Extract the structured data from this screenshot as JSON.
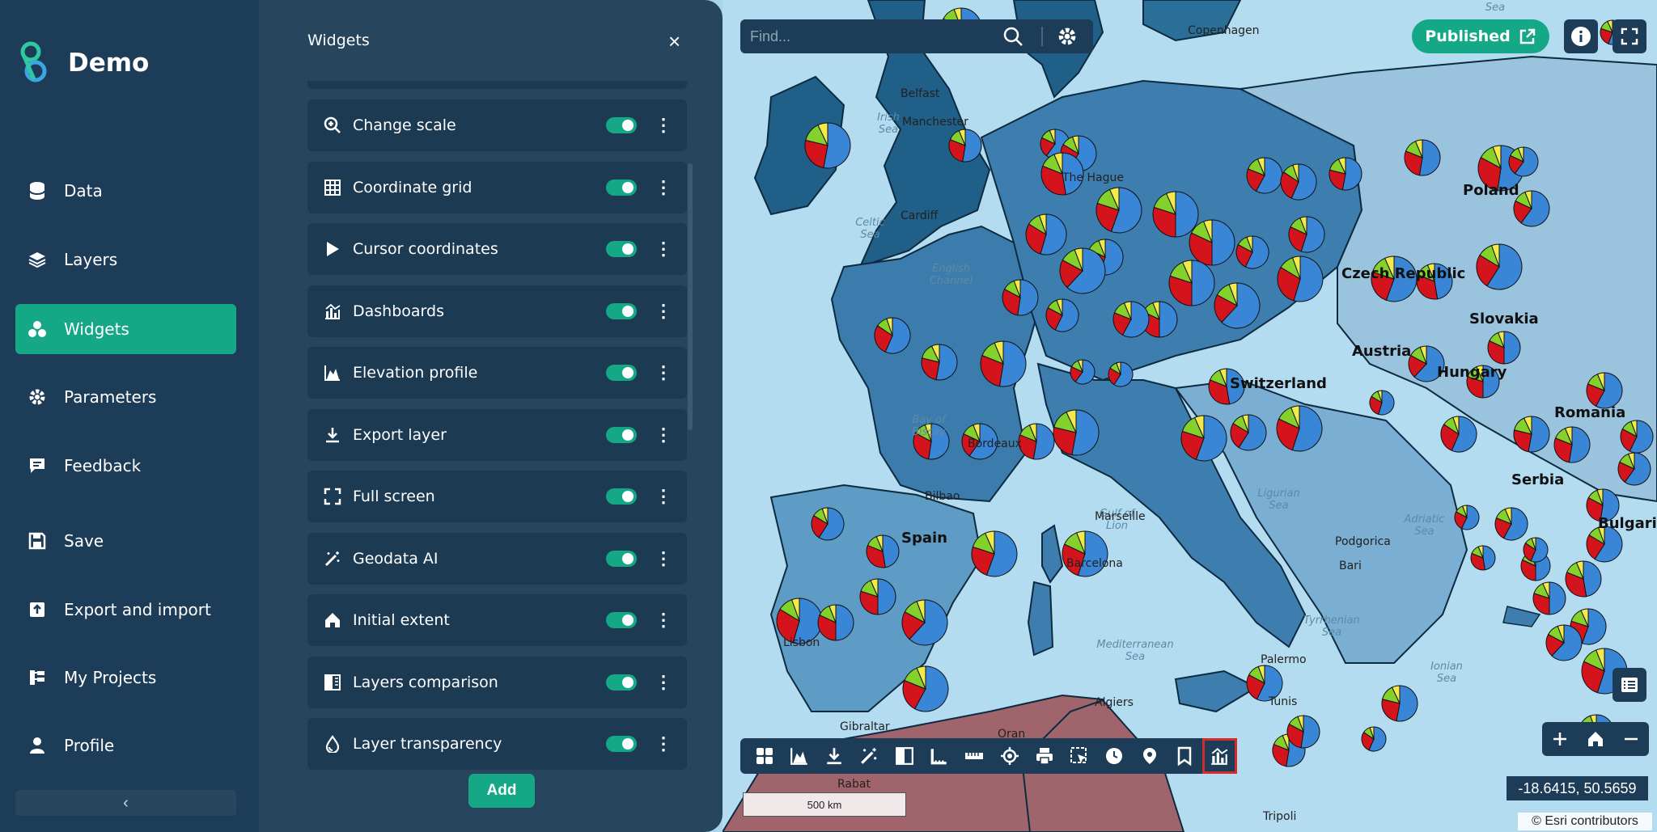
{
  "app": {
    "name": "Demo"
  },
  "sidebar": {
    "items": [
      {
        "label": "Data",
        "icon": "database-icon"
      },
      {
        "label": "Layers",
        "icon": "layers-icon"
      },
      {
        "label": "Widgets",
        "icon": "widgets-icon",
        "active": true
      },
      {
        "label": "Parameters",
        "icon": "gear-icon"
      },
      {
        "label": "Feedback",
        "icon": "feedback-icon"
      },
      {
        "label": "Save",
        "icon": "save-icon"
      },
      {
        "label": "Export and import",
        "icon": "export-import-icon"
      },
      {
        "label": "My Projects",
        "icon": "projects-icon"
      },
      {
        "label": "Profile",
        "icon": "profile-icon"
      }
    ],
    "collapse_label": "‹"
  },
  "panel": {
    "title": "Widgets",
    "close": "×",
    "add_label": "Add",
    "widgets": [
      {
        "label": "Change scale",
        "icon": "zoom-in-icon",
        "enabled": true
      },
      {
        "label": "Coordinate grid",
        "icon": "grid-icon",
        "enabled": true
      },
      {
        "label": "Cursor coordinates",
        "icon": "cursor-icon",
        "enabled": true
      },
      {
        "label": "Dashboards",
        "icon": "dashboard-icon",
        "enabled": true
      },
      {
        "label": "Elevation profile",
        "icon": "elevation-icon",
        "enabled": true
      },
      {
        "label": "Export layer",
        "icon": "download-icon",
        "enabled": true
      },
      {
        "label": "Full screen",
        "icon": "fullscreen-icon",
        "enabled": true
      },
      {
        "label": "Geodata AI",
        "icon": "magic-wand-icon",
        "enabled": true
      },
      {
        "label": "Initial extent",
        "icon": "home-icon",
        "enabled": true
      },
      {
        "label": "Layers comparison",
        "icon": "compare-icon",
        "enabled": true
      },
      {
        "label": "Layer transparency",
        "icon": "droplet-icon",
        "enabled": true
      }
    ]
  },
  "map": {
    "search_placeholder": "Find...",
    "published_label": "Published",
    "scale_label": "500 km",
    "coordinates": "-18.6415, 50.5659",
    "attribution": "© Esri contributors",
    "countries": [
      "Poland",
      "Czech Republic",
      "Austria",
      "Switzerland",
      "Slovakia",
      "Hungary",
      "Romania",
      "Serbia",
      "Bulgaria",
      "Spain"
    ],
    "seas": [
      "Bay of Biscay",
      "Celtic Sea",
      "English Channel",
      "Ligurian Sea",
      "Gulf of Lion",
      "Adriatic Sea",
      "Tyrrhenian Sea",
      "Mediterranean Sea",
      "Ionian Sea",
      "Irish Sea",
      "Sea"
    ],
    "cities": [
      "Marseille",
      "Barcelona",
      "The Hague",
      "Manchester",
      "Belfast",
      "Cardiff",
      "Bordeaux",
      "Bilbao",
      "Podgorica",
      "Bari",
      "Palermo",
      "Tunis",
      "Algiers",
      "Tripoli",
      "Gibraltar",
      "Rabat",
      "Oran",
      "Copenhagen",
      "Lisbon"
    ],
    "pie_colors": {
      "red": "#d4141c",
      "blue": "#3a86d6",
      "green": "#84d12b",
      "yellow": "#f2ea4a"
    },
    "toolbar_tools": [
      "dashboard-icon",
      "elevation-icon",
      "download-icon",
      "magic-wand-icon",
      "compare-icon",
      "ruler-icon",
      "measure-icon",
      "locate-icon",
      "print-icon",
      "select-icon",
      "clock-icon",
      "pin-icon",
      "bookmark-icon",
      "chart-icon"
    ],
    "highlighted_tool": "chart-icon"
  },
  "colors": {
    "accent": "#15a886",
    "sidebar": "#1c3c57",
    "panel": "#27455c",
    "card": "#1d3a53",
    "highlight": "#d62b2b"
  }
}
